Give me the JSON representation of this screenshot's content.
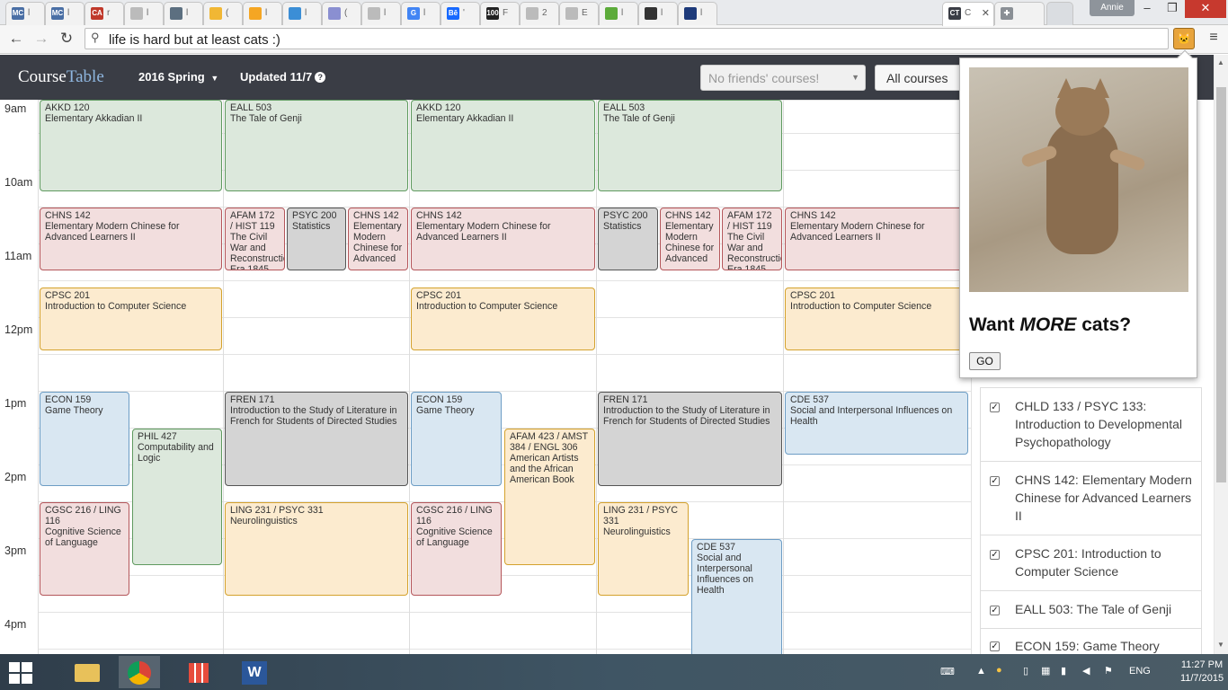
{
  "browser": {
    "tabs": [
      {
        "fav": "MC",
        "fav_color": "#4a6fa5",
        "title": "l"
      },
      {
        "fav": "MC",
        "fav_color": "#4a6fa5",
        "title": "l"
      },
      {
        "fav": "CA",
        "fav_color": "#c0392b",
        "title": "r"
      },
      {
        "fav": "",
        "fav_color": "#bbbbbb",
        "title": "l"
      },
      {
        "fav": "",
        "fav_color": "#5c6f80",
        "title": "l"
      },
      {
        "fav": "",
        "fav_color": "#f1b734",
        "title": "("
      },
      {
        "fav": "",
        "fav_color": "#f5a623",
        "title": "l"
      },
      {
        "fav": "",
        "fav_color": "#3b8ed6",
        "title": "l"
      },
      {
        "fav": "",
        "fav_color": "#8a8fd1",
        "title": "("
      },
      {
        "fav": "",
        "fav_color": "#bbbbbb",
        "title": "l"
      },
      {
        "fav": "G",
        "fav_color": "#4285f4",
        "title": "l"
      },
      {
        "fav": "Bē",
        "fav_color": "#1769ff",
        "title": "'"
      },
      {
        "fav": "100",
        "fav_color": "#222222",
        "title": "F"
      },
      {
        "fav": "",
        "fav_color": "#bbbbbb",
        "title": "2"
      },
      {
        "fav": "",
        "fav_color": "#bbbbbb",
        "title": "E"
      },
      {
        "fav": "",
        "fav_color": "#5cab3a",
        "title": "l"
      },
      {
        "fav": "",
        "fav_color": "#333333",
        "title": "l"
      },
      {
        "fav": "",
        "fav_color": "#1d3a7a",
        "title": "l"
      }
    ],
    "active_tab": {
      "fav": "CT",
      "title": "C"
    },
    "user": "Annie",
    "address": "life is hard but at least cats :)"
  },
  "app": {
    "brand_a": "Course",
    "brand_b": "Table",
    "term": "2016 Spring",
    "updated": "Updated 11/7",
    "friends_placeholder": "No friends' courses!",
    "all_courses": "All courses"
  },
  "calendar": {
    "times": [
      "9am",
      "10am",
      "11am",
      "12pm",
      "1pm",
      "2pm",
      "3pm",
      "4pm"
    ],
    "events": [
      {
        "code": "AKKD 120",
        "name": "Elementary Akkadian II",
        "color": "green"
      },
      {
        "code": "EALL 503",
        "name": "The Tale of Genji",
        "color": "green"
      },
      {
        "code": "AKKD 120",
        "name": "Elementary Akkadian II",
        "color": "green"
      },
      {
        "code": "EALL 503",
        "name": "The Tale of Genji",
        "color": "green"
      },
      {
        "code": "CHNS 142",
        "name": "Elementary Modern Chinese for Advanced Learners II",
        "color": "red"
      },
      {
        "code": "AFAM 172 / HIST 119",
        "name": "The Civil War and Reconstruction Era 1845",
        "color": "red"
      },
      {
        "code": "PSYC 200",
        "name": "Statistics",
        "color": "gray"
      },
      {
        "code": "CHNS 142",
        "name": "Elementary Modern Chinese for Advanced",
        "color": "red"
      },
      {
        "code": "CHNS 142",
        "name": "Elementary Modern Chinese for Advanced Learners II",
        "color": "red"
      },
      {
        "code": "PSYC 200",
        "name": "Statistics",
        "color": "gray"
      },
      {
        "code": "CHNS 142",
        "name": "Elementary Modern Chinese for Advanced",
        "color": "red"
      },
      {
        "code": "AFAM 172 / HIST 119",
        "name": "The Civil War and Reconstruction Era 1845",
        "color": "red"
      },
      {
        "code": "CHNS 142",
        "name": "Elementary Modern Chinese for Advanced Learners II",
        "color": "red"
      },
      {
        "code": "CPSC 201",
        "name": "Introduction to Computer Science",
        "color": "orange"
      },
      {
        "code": "CPSC 201",
        "name": "Introduction to Computer Science",
        "color": "orange"
      },
      {
        "code": "CPSC 201",
        "name": "Introduction to Computer Science",
        "color": "orange"
      },
      {
        "code": "ECON 159",
        "name": "Game Theory",
        "color": "blue"
      },
      {
        "code": "PHIL 427",
        "name": "Computability and Logic",
        "color": "green"
      },
      {
        "code": "FREN 171",
        "name": "Introduction to the Study of Literature in French for Students of Directed Studies",
        "color": "gray"
      },
      {
        "code": "ECON 159",
        "name": "Game Theory",
        "color": "blue"
      },
      {
        "code": "AFAM 423 / AMST 384 / ENGL 306",
        "name": "American Artists and the African American Book",
        "color": "orange"
      },
      {
        "code": "FREN 171",
        "name": "Introduction to the Study of Literature in French for Students of Directed Studies",
        "color": "gray"
      },
      {
        "code": "CDE 537",
        "name": "Social and Interpersonal Influences on Health",
        "color": "blue"
      },
      {
        "code": "CGSC 216 / LING 116",
        "name": "Cognitive Science of Language",
        "color": "red"
      },
      {
        "code": "LING 231 / PSYC 331",
        "name": "Neurolinguistics",
        "color": "orange"
      },
      {
        "code": "CGSC 216 / LING 116",
        "name": "Cognitive Science of Language",
        "color": "red"
      },
      {
        "code": "LING 231 / PSYC 331",
        "name": "Neurolinguistics",
        "color": "orange"
      },
      {
        "code": "CDE 537",
        "name": "Social and Interpersonal Influences on Health",
        "color": "blue"
      }
    ]
  },
  "course_list": [
    {
      "label": "CHLD 133 / PSYC 133: Introduction to Developmental Psychopathology",
      "checked": true
    },
    {
      "label": "CHNS 142: Elementary Modern Chinese for Advanced Learners II",
      "checked": true
    },
    {
      "label": "CPSC 201: Introduction to Computer Science",
      "checked": true
    },
    {
      "label": "EALL 503: The Tale of Genji",
      "checked": true
    },
    {
      "label": "ECON 159: Game Theory",
      "checked": true
    }
  ],
  "popup": {
    "headline_a": "Want ",
    "headline_em": "MORE",
    "headline_b": " cats?",
    "button": "GO"
  },
  "taskbar": {
    "lang": "ENG",
    "time": "11:27 PM",
    "date": "11/7/2015"
  },
  "colors": {
    "nav_bg": "#3a3d45",
    "green": "#dce8dc",
    "red": "#f2dede",
    "orange": "#fcebcf",
    "blue": "#d9e7f2",
    "gray": "#d4d4d4"
  }
}
